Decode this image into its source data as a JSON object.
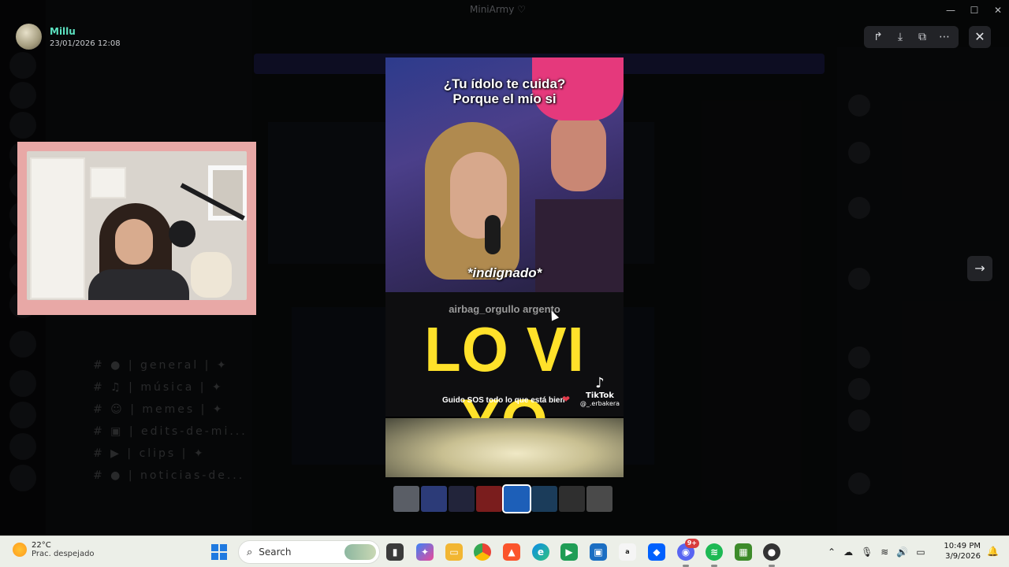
{
  "window": {
    "title": "MiniArmy ♡"
  },
  "viewer": {
    "poster_name": "Millu",
    "poster_timestamp": "23/01/2026 12:08",
    "toolbar_icons": [
      "forward-icon",
      "download-icon",
      "open-external-icon",
      "more-icon"
    ],
    "close_label": "✕",
    "next_label": "→"
  },
  "video": {
    "caption_question": "¿Tu ídolo te cuida?\nPorque el mío si",
    "caption_reaction": "*indignado*",
    "watermark_handle": "airbag_orgullo argento",
    "headline": "LO VI YO",
    "subtitle": "Guido SOS todo lo que está bien",
    "tiktok_brand": "TikTok",
    "tiktok_user": "@_.erbakera"
  },
  "thumbnails": {
    "count": 8,
    "selected_index": 4,
    "colors": [
      "#5a5e66",
      "#2c3b78",
      "#22243a",
      "#7a1d1d",
      "#1d5fb8",
      "#1b3c5a",
      "#2f2f2f",
      "#4a4a4a"
    ]
  },
  "taskbar": {
    "weather_temp": "22°C",
    "weather_desc": "Prac. despejado",
    "search_placeholder": "Search",
    "clock_time": "10:49 PM",
    "clock_date": "3/9/2026",
    "discord_badge": "9+"
  }
}
